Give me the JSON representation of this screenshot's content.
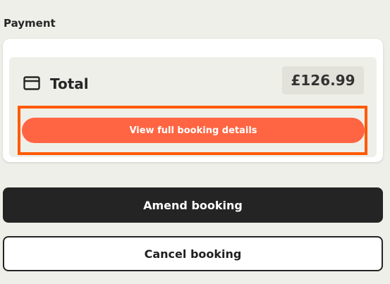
{
  "payment": {
    "heading": "Payment",
    "total_label": "Total",
    "total_amount": "£126.99",
    "card_icon": "credit-card-icon",
    "view_details_label": "View full booking details"
  },
  "actions": {
    "amend_label": "Amend booking",
    "cancel_label": "Cancel booking"
  },
  "colors": {
    "accent_orange": "#ff6542",
    "highlight_orange": "#ff5a00",
    "dark_button": "#242424",
    "background": "#efefe9"
  }
}
